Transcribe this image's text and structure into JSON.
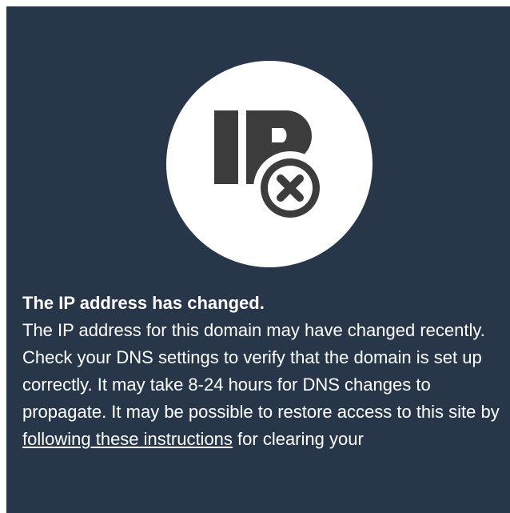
{
  "icon": {
    "name": "ip-error-icon",
    "text": "IP",
    "circle_color": "#ffffff",
    "glyph_color": "#3c3c3c",
    "background_color": "#273749"
  },
  "message": {
    "title": "The IP address has changed.",
    "body_before_link": "The IP address for this domain may have changed recently. Check your DNS settings to verify that the domain is set up correctly. It may take 8-24 hours for DNS changes to propagate. It may be possible to restore access to this site by ",
    "link_text": "following these instructions",
    "body_after_link": " for clearing your"
  }
}
